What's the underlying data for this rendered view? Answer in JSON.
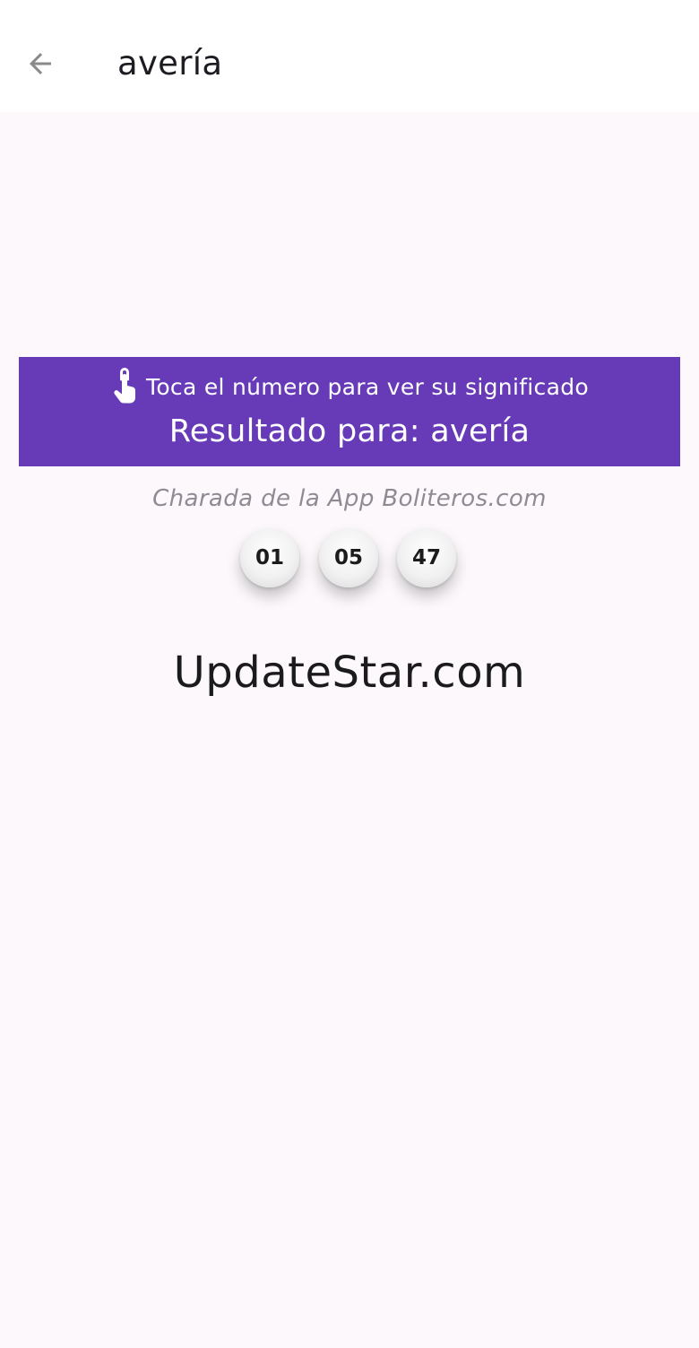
{
  "header": {
    "back_icon": "arrow-left-icon",
    "title": "avería"
  },
  "banner": {
    "hint_icon": "touch-hand-icon",
    "hint": "Toca el número para ver su significado",
    "result_title": "Resultado para: avería",
    "background_color": "#673ab7"
  },
  "source": "Charada de la App Boliteros.com",
  "numbers": [
    "01",
    "05",
    "47"
  ],
  "watermark": "UpdateStar.com"
}
